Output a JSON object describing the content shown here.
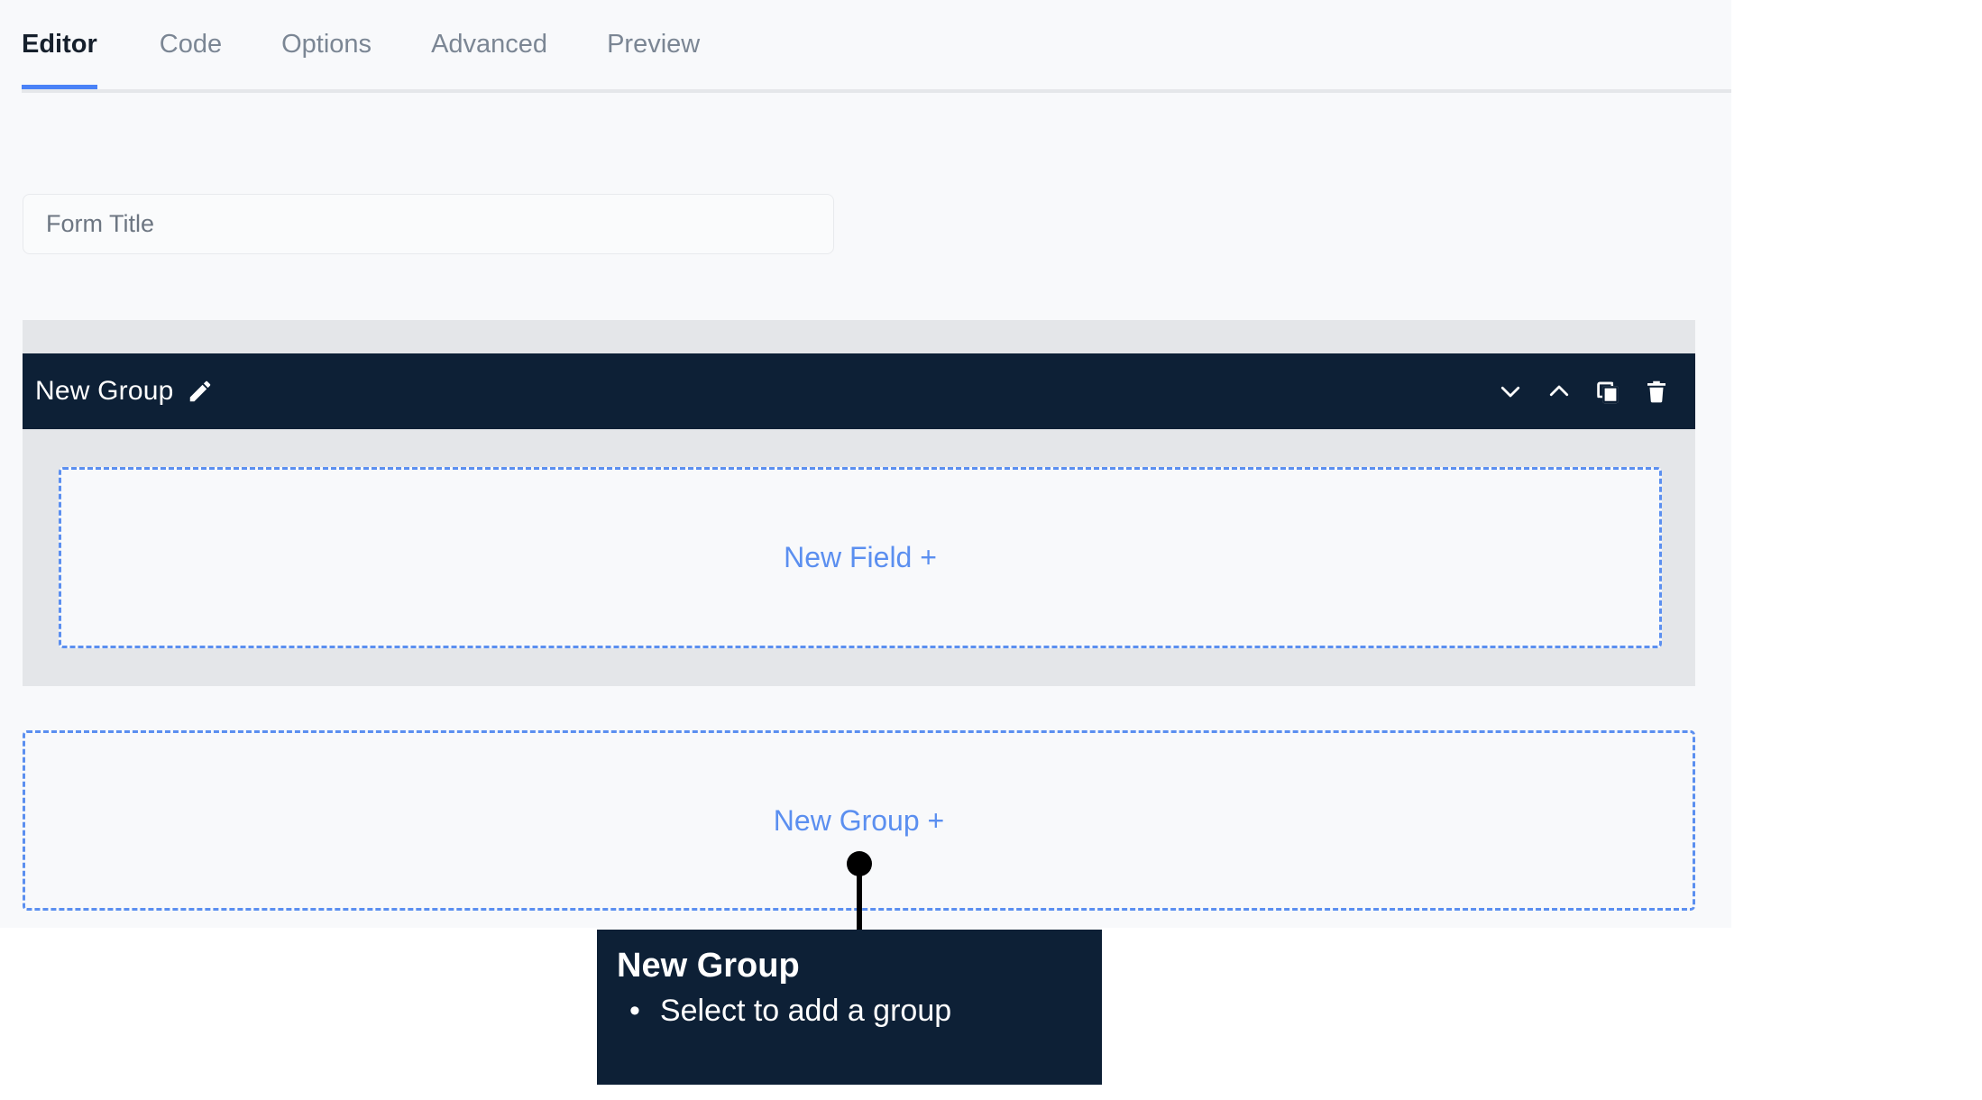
{
  "tabs": [
    {
      "label": "Editor",
      "active": true
    },
    {
      "label": "Code",
      "active": false
    },
    {
      "label": "Options",
      "active": false
    },
    {
      "label": "Advanced",
      "active": false
    },
    {
      "label": "Preview",
      "active": false
    }
  ],
  "form": {
    "title_value": "",
    "title_placeholder": "Form Title"
  },
  "group": {
    "name": "New Group",
    "edit_icon": "pencil-icon",
    "actions": [
      {
        "name": "collapse-down",
        "icon": "chevron-down-icon"
      },
      {
        "name": "collapse-up",
        "icon": "chevron-up-icon"
      },
      {
        "name": "duplicate",
        "icon": "copy-icon"
      },
      {
        "name": "delete",
        "icon": "trash-icon"
      }
    ],
    "new_field_label": "New Field +"
  },
  "new_group_label": "New Group +",
  "callout": {
    "title": "New Group",
    "bullet": "•",
    "items": [
      "Select to add a group"
    ]
  },
  "colors": {
    "accent_blue": "#5b8ff0",
    "tab_underline_blue": "#4a82f7",
    "dark_navy": "#0d2036",
    "panel_bg": "#f8f9fb",
    "group_gray": "#e4e6e9",
    "border_gray": "#e5e7ea",
    "muted_text": "#7b8694"
  }
}
